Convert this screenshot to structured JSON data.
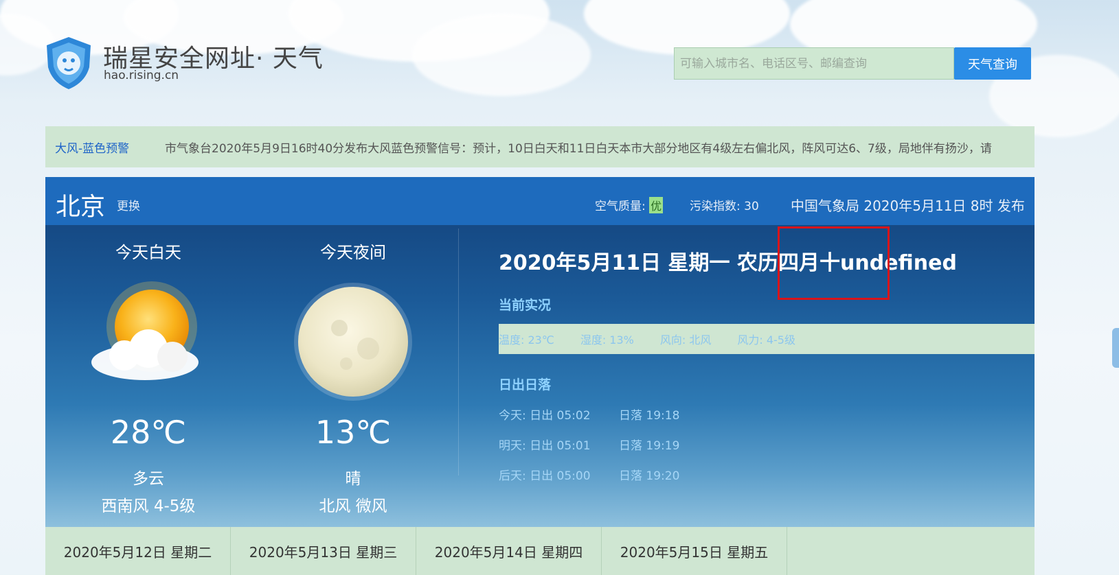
{
  "site": {
    "title": "瑞星安全网址· 天气",
    "url": "hao.rising.cn",
    "logo_icon": "lion-shield-icon"
  },
  "search": {
    "placeholder": "可输入城市名、电话区号、邮编查询",
    "button_label": "天气查询"
  },
  "alert": {
    "title": "大风-蓝色预警",
    "text": "市气象台2020年5月9日16时40分发布大风蓝色预警信号：预计，10日白天和11日白天本市大部分地区有4级左右偏北风，阵风可达6、7级，局地伴有扬沙，请"
  },
  "header": {
    "city": "北京",
    "change_label": "更换",
    "air_quality_label": "空气质量:",
    "air_quality_value": "优",
    "pollution_label": "污染指数: 30",
    "publisher": "中国气象局 2020年5月11日 8时 发布"
  },
  "day": {
    "title": "今天白天",
    "icon": "partly-cloudy-sun-icon",
    "temp": "28℃",
    "desc": "多云",
    "wind": "西南风 4-5级"
  },
  "night": {
    "title": "今天夜间",
    "icon": "full-moon-icon",
    "temp": "13℃",
    "desc": "晴",
    "wind": "北风 微风"
  },
  "date_line": "2020年5月11日 星期一 农历四月十undefined",
  "current": {
    "title": "当前实况",
    "temperature": "温度: 23℃",
    "humidity": "湿度: 13%",
    "wind_dir": "风向: 北风",
    "wind_force": "风力: 4-5级"
  },
  "sun": {
    "title": "日出日落",
    "rows": [
      {
        "rise": "今天: 日出 05:02",
        "set": "日落 19:18"
      },
      {
        "rise": "明天: 日出 05:01",
        "set": "日落 19:19"
      },
      {
        "rise": "后天: 日出 05:00",
        "set": "日落 19:20"
      }
    ]
  },
  "forecast_tabs": [
    "2020年5月12日 星期二",
    "2020年5月13日 星期三",
    "2020年5月14日 星期四",
    "2020年5月15日 星期五"
  ],
  "colors": {
    "panel_header": "#1e6bbd",
    "accent_button": "#2b8de6",
    "alert_bg": "#cfe6d2",
    "highlight": "#d9141a"
  }
}
